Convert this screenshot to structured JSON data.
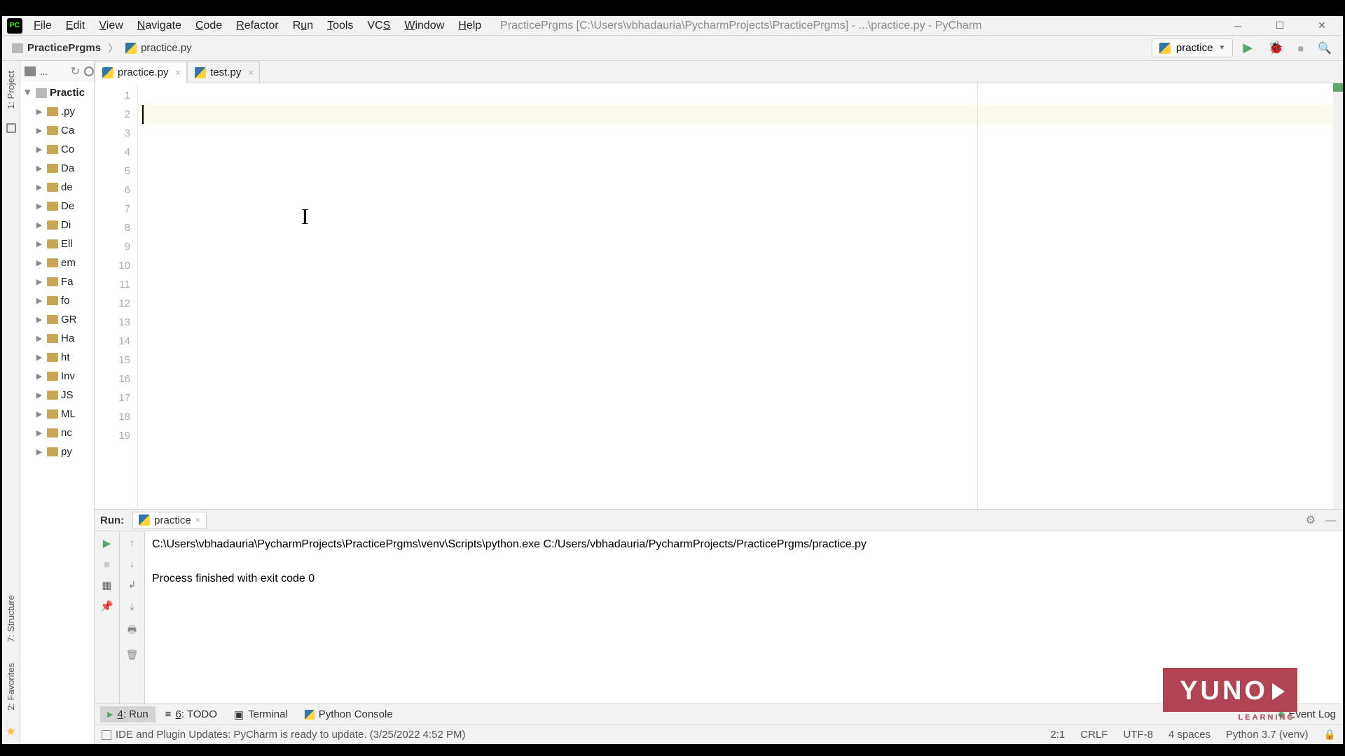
{
  "menu": {
    "file": "File",
    "edit": "Edit",
    "view": "View",
    "navigate": "Navigate",
    "code": "Code",
    "refactor": "Refactor",
    "run": "Run",
    "tools": "Tools",
    "vcs": "VCS",
    "window": "Window",
    "help": "Help"
  },
  "window_title": "PracticePrgms [C:\\Users\\vbhadauria\\PycharmProjects\\PracticePrgms] - ...\\practice.py - PyCharm",
  "breadcrumb": {
    "root": "PracticePrgms",
    "file": "practice.py"
  },
  "run_config": "practice",
  "project_tree": {
    "root": "Practic",
    "items": [
      ".py",
      "Ca",
      "Co",
      "Da",
      "de",
      "De",
      "Di",
      "Ell",
      "em",
      "Fa",
      "fo",
      "GR",
      "Ha",
      "ht",
      "Inv",
      "JS",
      "ML",
      "nc",
      "py"
    ]
  },
  "tabs": [
    {
      "name": "practice.py",
      "active": true
    },
    {
      "name": "test.py",
      "active": false
    }
  ],
  "line_numbers": [
    "1",
    "2",
    "3",
    "4",
    "5",
    "6",
    "7",
    "8",
    "9",
    "10",
    "11",
    "12",
    "13",
    "14",
    "15",
    "16",
    "17",
    "18",
    "19"
  ],
  "run_panel": {
    "label": "Run:",
    "tab": "practice",
    "output_line1": "C:\\Users\\vbhadauria\\PycharmProjects\\PracticePrgms\\venv\\Scripts\\python.exe C:/Users/vbhadauria/PycharmProjects/PracticePrgms/practice.py",
    "output_line2": "Process finished with exit code 0"
  },
  "bottom_tools": {
    "run": "4: Run",
    "todo": "6: TODO",
    "terminal": "Terminal",
    "pyconsole": "Python Console",
    "eventlog": "Event Log"
  },
  "status": {
    "message": "IDE and Plugin Updates: PyCharm is ready to update. (3/25/2022 4:52 PM)",
    "pos": "2:1",
    "lineend": "CRLF",
    "enc": "UTF-8",
    "indent": "4 spaces",
    "interp": "Python 3.7 (venv)"
  },
  "sidebar_labels": {
    "project": "1: Project",
    "structure": "7: Structure",
    "favorites": "2: Favorites"
  },
  "logo": {
    "text": "YUNO",
    "sub": "LEARNING"
  }
}
